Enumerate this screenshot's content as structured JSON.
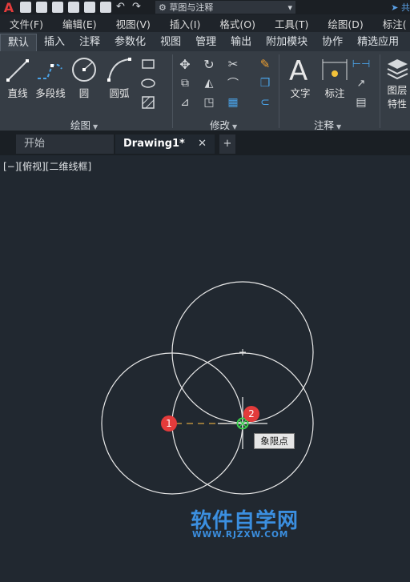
{
  "quick_access": {
    "workspace": "草图与注释",
    "share": "共"
  },
  "menubar": {
    "items": [
      "文件(F)",
      "编辑(E)",
      "视图(V)",
      "插入(I)",
      "格式(O)",
      "工具(T)",
      "绘图(D)",
      "标注("
    ]
  },
  "ribbon_tabs": [
    "默认",
    "插入",
    "注释",
    "参数化",
    "视图",
    "管理",
    "输出",
    "附加模块",
    "协作",
    "精选应用"
  ],
  "ribbon": {
    "draw_panel": {
      "label": "绘图",
      "line": "直线",
      "polyline": "多段线",
      "circle": "圆",
      "arc": "圆弧"
    },
    "modify_panel": {
      "label": "修改"
    },
    "annotation_panel": {
      "label": "注释",
      "text": "文字",
      "dimension": "标注"
    },
    "layer_panel": {
      "label1": "图层",
      "label2": "特性"
    }
  },
  "file_tabs": {
    "start": "开始",
    "drawing": "Drawing1*",
    "close": "✕",
    "add": "+"
  },
  "viewport": {
    "label": "[−][俯视][二维线框]",
    "tooltip": "象限点",
    "marker1": "1",
    "marker2": "2"
  },
  "watermark": {
    "title": "软件自学网",
    "url": "WWW.RJZXW.COM"
  },
  "colors": {
    "background": "#212830",
    "circle_stroke": "#e8e8e8",
    "snap_marker": "#3ccf4e",
    "marker_red": "#e33b3b",
    "tracking_line": "#d9a441"
  }
}
